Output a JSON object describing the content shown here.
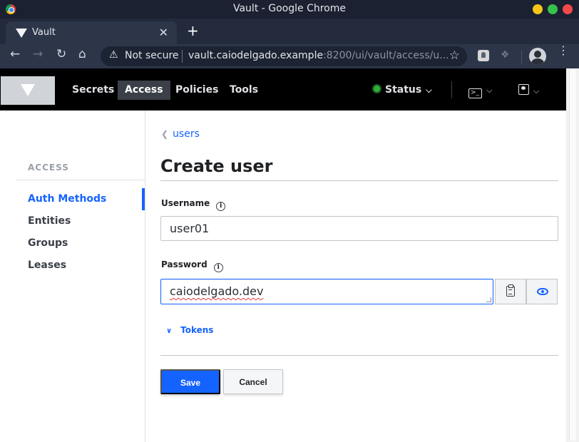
{
  "window": {
    "title": "Vault - Google Chrome"
  },
  "tab": {
    "title": "Vault",
    "close": "✕",
    "new_tab": "+"
  },
  "toolbar": {
    "security_text": "Not secure",
    "url_host": "vault.caiodelgado.example",
    "url_path": ":8200/ui/vault/access/u..."
  },
  "vault_nav": {
    "items": [
      {
        "label": "Secrets",
        "active": false
      },
      {
        "label": "Access",
        "active": true
      },
      {
        "label": "Policies",
        "active": false
      },
      {
        "label": "Tools",
        "active": false
      }
    ],
    "status_label": "Status"
  },
  "sidebar": {
    "heading": "ACCESS",
    "items": [
      {
        "label": "Auth Methods",
        "active": true
      },
      {
        "label": "Entities",
        "active": false
      },
      {
        "label": "Groups",
        "active": false
      },
      {
        "label": "Leases",
        "active": false
      }
    ]
  },
  "form": {
    "breadcrumb": "users",
    "title": "Create user",
    "username_label": "Username",
    "username_value": "user01",
    "password_label": "Password",
    "password_value": "caiodelgado.dev",
    "tokens_label": "Tokens",
    "save_label": "Save",
    "cancel_label": "Cancel"
  },
  "colors": {
    "accent": "#1563ff",
    "nav_bg": "#000000",
    "status_ok": "#2eb039"
  }
}
